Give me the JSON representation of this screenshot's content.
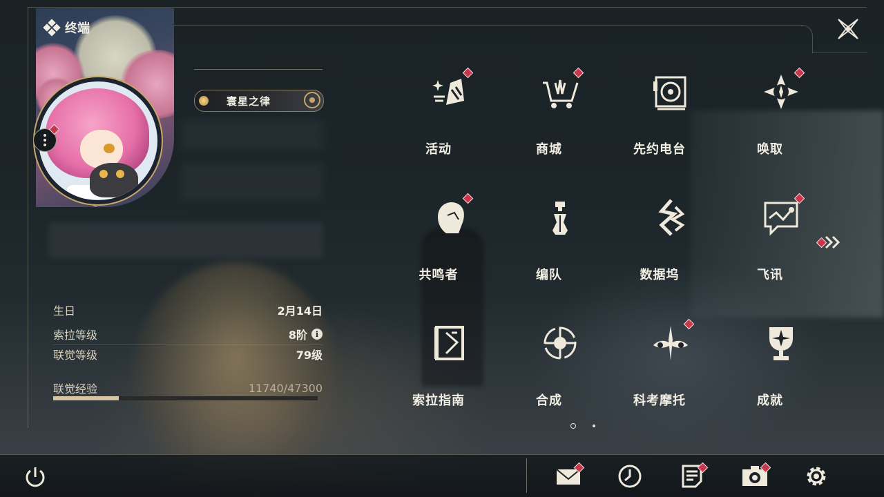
{
  "header": {
    "title": "终端"
  },
  "profile": {
    "title_badge": "寰星之律",
    "birthday_label": "生日",
    "birthday_value": "2月14日",
    "sola_level_label": "索拉等级",
    "sola_level_value": "8阶",
    "union_level_label": "联觉等级",
    "union_level_value": "79级",
    "exp_label": "联觉经验",
    "exp_value": "11740/47300",
    "exp_current": 11740,
    "exp_max": 47300
  },
  "menu": {
    "items": [
      {
        "label": "活动",
        "icon": "activity-icon",
        "badge": true
      },
      {
        "label": "商城",
        "icon": "shop-basket-icon",
        "badge": true
      },
      {
        "label": "先约电台",
        "icon": "radio-icon",
        "badge": false
      },
      {
        "label": "唤取",
        "icon": "summon-compass-icon",
        "badge": true
      },
      {
        "label": "共鸣者",
        "icon": "resonator-portrait-icon",
        "badge": true
      },
      {
        "label": "编队",
        "icon": "team-chess-icon",
        "badge": false
      },
      {
        "label": "数据坞",
        "icon": "data-dock-icon",
        "badge": false
      },
      {
        "label": "飞讯",
        "icon": "message-chat-icon",
        "badge": true
      },
      {
        "label": "索拉指南",
        "icon": "guidebook-icon",
        "badge": false
      },
      {
        "label": "合成",
        "icon": "synthesis-icon",
        "badge": false
      },
      {
        "label": "科考摩托",
        "icon": "motorcycle-icon",
        "badge": true
      },
      {
        "label": "成就",
        "icon": "trophy-icon",
        "badge": false
      }
    ],
    "page_count": 2,
    "current_page": 1
  },
  "bottom": {
    "icons": [
      {
        "name": "mail-icon",
        "badge": true
      },
      {
        "name": "clock-icon",
        "badge": false
      },
      {
        "name": "notice-icon",
        "badge": true
      },
      {
        "name": "camera-icon",
        "badge": true
      },
      {
        "name": "settings-gear-icon",
        "badge": false
      }
    ]
  },
  "colors": {
    "accent_gold": "#c7a56a",
    "badge_red": "#c8384c",
    "text": "#f2eee4"
  }
}
